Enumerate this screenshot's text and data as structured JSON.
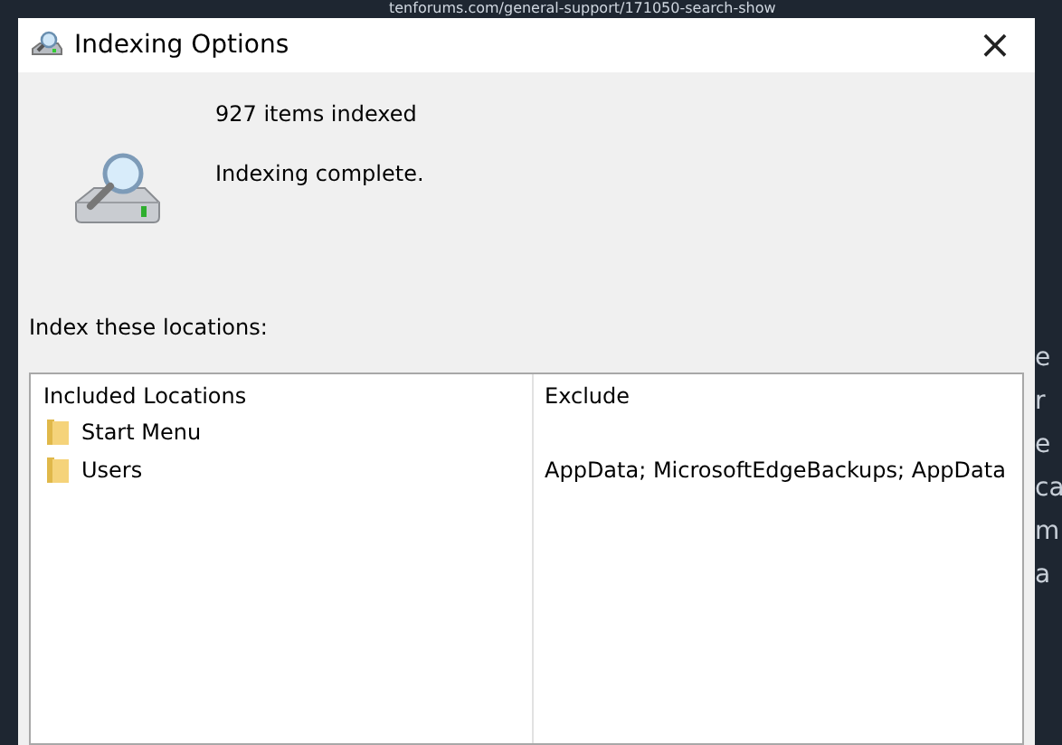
{
  "background": {
    "address": "tenforums.com/general-support/171050-search-show",
    "fragments": [
      "e",
      "r",
      "e",
      "ca",
      "m",
      "a"
    ]
  },
  "window": {
    "title": "Indexing Options",
    "close": "×"
  },
  "status": {
    "count": "927 items indexed",
    "message": "Indexing complete."
  },
  "locations_label": "Index these locations:",
  "table": {
    "columns": [
      "Included Locations",
      "Exclude"
    ],
    "rows": [
      {
        "name": "Start Menu",
        "exclude": ""
      },
      {
        "name": "Users",
        "exclude": "AppData; MicrosoftEdgeBackups; AppData"
      }
    ]
  }
}
